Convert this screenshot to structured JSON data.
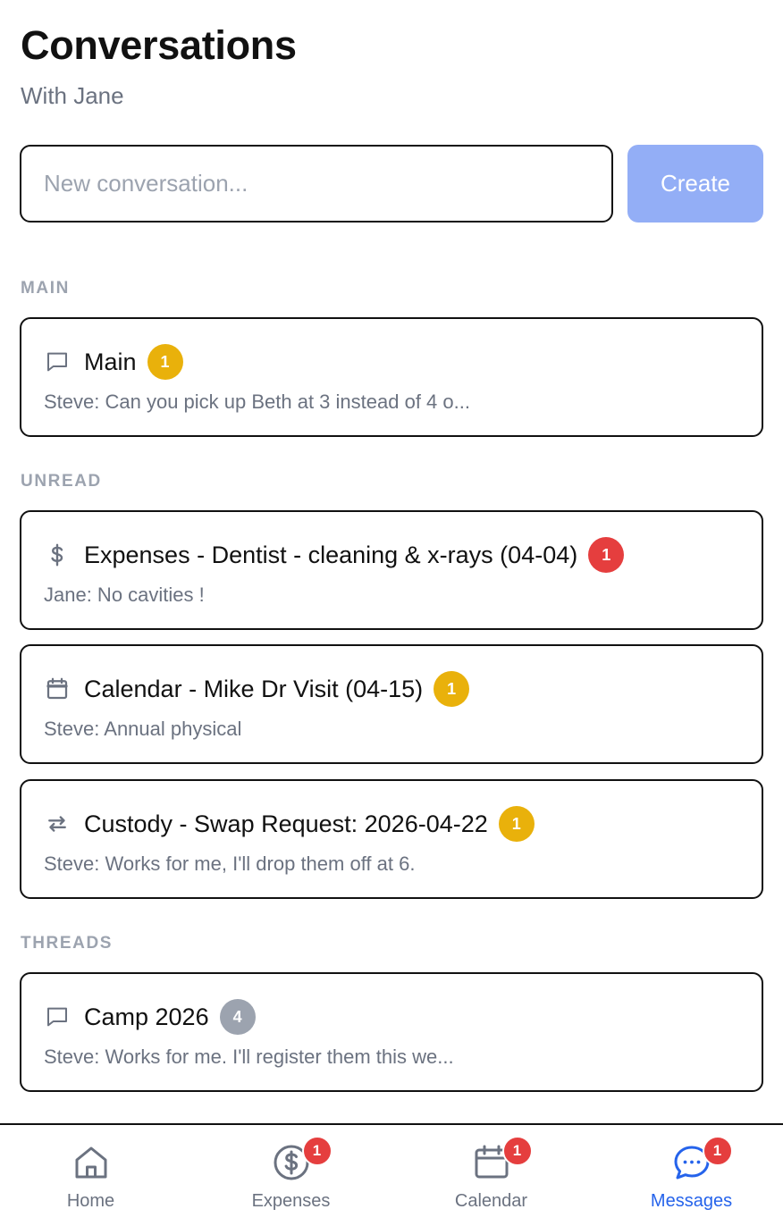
{
  "header": {
    "title": "Conversations",
    "subtitle": "With Jane"
  },
  "composer": {
    "placeholder": "New conversation...",
    "value": "",
    "create_label": "Create"
  },
  "sections": {
    "main": {
      "label": "MAIN",
      "items": [
        {
          "icon": "chat-bubble-icon",
          "title": "Main",
          "badge": "1",
          "badge_color": "#e9b10b",
          "preview": "Steve: Can you pick up Beth at 3 instead of 4 o..."
        }
      ]
    },
    "unread": {
      "label": "UNREAD",
      "items": [
        {
          "icon": "dollar-icon",
          "title": "Expenses - Dentist - cleaning & x-rays (04-04)",
          "badge": "1",
          "badge_color": "#e53e3e",
          "preview": "Jane: No cavities !"
        },
        {
          "icon": "calendar-icon",
          "title": "Calendar - Mike Dr Visit (04-15)",
          "badge": "1",
          "badge_color": "#e9b10b",
          "preview": "Steve: Annual physical"
        },
        {
          "icon": "swap-arrows-icon",
          "title": "Custody - Swap Request: 2026-04-22",
          "badge": "1",
          "badge_color": "#e9b10b",
          "preview": "Steve: Works for me, I'll drop them off at 6."
        }
      ]
    },
    "threads": {
      "label": "THREADS",
      "items": [
        {
          "icon": "chat-bubble-icon",
          "title": "Camp 2026",
          "badge": "4",
          "badge_color": "#9ca3af",
          "preview": "Steve: Works for me. I'll register them this we..."
        }
      ]
    }
  },
  "tabbar": {
    "tabs": [
      {
        "label": "Home",
        "icon": "home-icon",
        "badge": null,
        "active": false
      },
      {
        "label": "Expenses",
        "icon": "dollar-circle-icon",
        "badge": "1",
        "active": false
      },
      {
        "label": "Calendar",
        "icon": "calendar-icon",
        "badge": "1",
        "active": false
      },
      {
        "label": "Messages",
        "icon": "message-bubble-icon",
        "badge": "1",
        "active": true
      }
    ],
    "active_color": "#2563eb",
    "badge_color": "#e53e3e"
  }
}
